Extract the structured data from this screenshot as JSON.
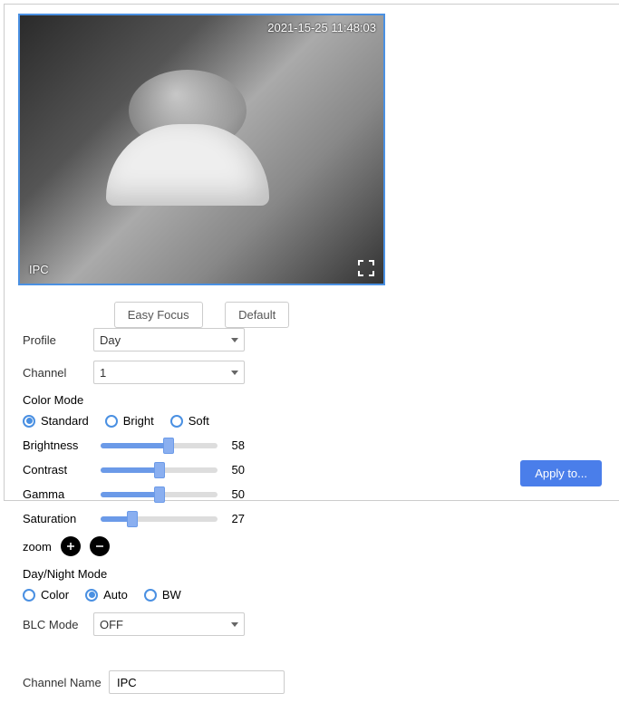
{
  "video": {
    "timestamp": "2021-15-25 11:48:03",
    "overlay_label": "IPC"
  },
  "buttons": {
    "easy_focus": "Easy Focus",
    "default": "Default",
    "apply": "Apply to..."
  },
  "profile": {
    "label": "Profile",
    "value": "Day"
  },
  "channel": {
    "label": "Channel",
    "value": "1"
  },
  "color_mode": {
    "label": "Color Mode",
    "selected": "Standard",
    "options": {
      "standard": "Standard",
      "bright": "Bright",
      "soft": "Soft"
    }
  },
  "sliders": {
    "brightness": {
      "label": "Brightness",
      "value": 58
    },
    "contrast": {
      "label": "Contrast",
      "value": 50
    },
    "gamma": {
      "label": "Gamma",
      "value": 50
    },
    "saturation": {
      "label": "Saturation",
      "value": 27
    }
  },
  "zoom": {
    "label": "zoom"
  },
  "day_night": {
    "label": "Day/Night Mode",
    "selected": "Auto",
    "options": {
      "color": "Color",
      "auto": "Auto",
      "bw": "BW"
    }
  },
  "blc": {
    "label": "BLC Mode",
    "value": "OFF"
  },
  "channel_name": {
    "label": "Channel Name",
    "value": "IPC"
  }
}
